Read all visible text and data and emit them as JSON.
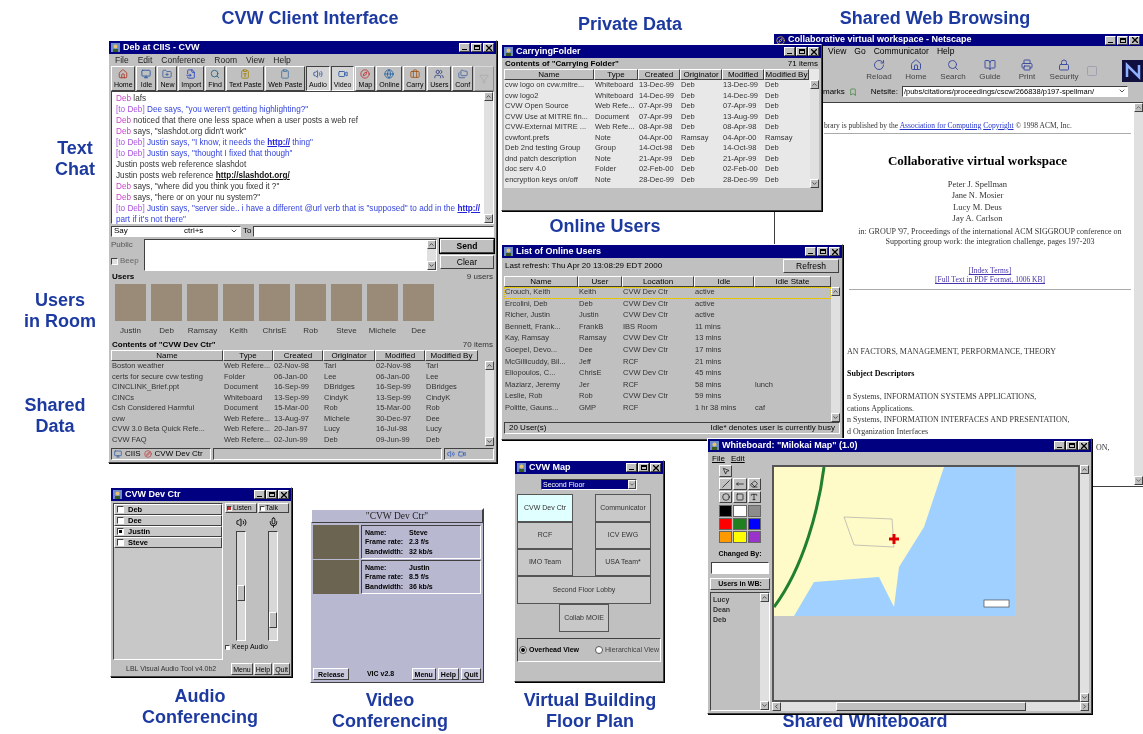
{
  "captions": [
    {
      "lines": [
        "CVW Client Interface"
      ]
    },
    {
      "lines": [
        "Private Data"
      ]
    },
    {
      "lines": [
        "Shared Web Browsing"
      ]
    },
    {
      "lines": [
        "Text",
        "Chat"
      ]
    },
    {
      "lines": [
        "Users",
        "in Room"
      ]
    },
    {
      "lines": [
        "Shared",
        "Data"
      ]
    },
    {
      "lines": [
        "Online Users"
      ]
    },
    {
      "lines": [
        "Audio",
        "Conferencing"
      ]
    },
    {
      "lines": [
        "Video",
        "Conferencing"
      ]
    },
    {
      "lines": [
        "Virtual Building",
        "Floor Plan"
      ]
    },
    {
      "lines": [
        "Shared Whiteboard"
      ]
    }
  ],
  "client": {
    "title": "Deb at CIIS - CVW",
    "menu": [
      "File",
      "Edit",
      "Conference",
      "Room",
      "View",
      "Help"
    ],
    "toolbar": [
      {
        "label": "Home",
        "pressed": false,
        "disabled": false
      },
      {
        "label": "Idle",
        "pressed": false,
        "disabled": false
      },
      {
        "label": "New",
        "pressed": false,
        "disabled": false
      },
      {
        "label": "Import",
        "pressed": false,
        "disabled": false
      },
      {
        "label": "Find",
        "pressed": false,
        "disabled": false
      },
      {
        "label": "Text Paste",
        "pressed": false,
        "disabled": false
      },
      {
        "label": "Web Paste",
        "pressed": false,
        "disabled": false
      },
      {
        "label": "Audio",
        "pressed": true,
        "disabled": false
      },
      {
        "label": "Video",
        "pressed": true,
        "disabled": false
      },
      {
        "label": "Map",
        "pressed": false,
        "disabled": false
      },
      {
        "label": "Online",
        "pressed": false,
        "disabled": false
      },
      {
        "label": "Carry",
        "pressed": false,
        "disabled": false
      },
      {
        "label": "Users",
        "pressed": false,
        "disabled": false
      },
      {
        "label": "Conf",
        "pressed": false,
        "disabled": false
      },
      {
        "pressed": false,
        "disabled": true
      }
    ],
    "chat": [
      {
        "kind": "say",
        "who": "Deb",
        "text": "lafs"
      },
      {
        "kind": "private",
        "prefix": "[to Deb]",
        "text": "Dee says, \"you weren't getting highlighting?\""
      },
      {
        "kind": "say",
        "who": "Deb",
        "text": "noticed that there one less space when a user posts a web ref"
      },
      {
        "kind": "say",
        "who": "Deb",
        "text": "says, \"slashdot.org didn't work\""
      },
      {
        "kind": "private",
        "prefix": "[to Deb]",
        "text": "Justin says, \"I know, it needs the",
        "link": "http://",
        "rest": "thing\""
      },
      {
        "kind": "private",
        "prefix": "[to Deb]",
        "text": "Justin says, \"thought I fixed that though\""
      },
      {
        "kind": "plain",
        "text": "Justin posts web reference slashdot"
      },
      {
        "kind": "plain",
        "text": "Justin posts web reference",
        "link": "http://slashdot.org/"
      },
      {
        "kind": "say",
        "who": "Deb",
        "text": "says, \"where did you think you fixed it ?\""
      },
      {
        "kind": "say",
        "who": "Deb",
        "text": "says, \"here or on your nu system?\""
      },
      {
        "kind": "private",
        "prefix": "[to Deb]",
        "text": "Justin says, \"server side.. i have a different @url verb that is \"supposed\" to add in the",
        "link": "http://",
        "rest": "part if it's not there\""
      }
    ],
    "say": {
      "mode": "Say",
      "shortcut": "ctrl+s",
      "to_label": "To"
    },
    "public_label": "Public",
    "beep": {
      "label": "Beep",
      "checked": false
    },
    "send": "Send",
    "clear": "Clear",
    "users_label": "Users",
    "users_count": "9 users",
    "users": [
      "Justin",
      "Deb",
      "Ramsay",
      "Keith",
      "ChrisE",
      "Rob",
      "Steve",
      "Michele",
      "Dee"
    ],
    "contents_title": "Contents of \"CVW Dev Ctr\"",
    "contents_count": "70 items",
    "columns": [
      "Name",
      "Type",
      "Created",
      "Originator",
      "Modified",
      "Modified By"
    ],
    "rows": [
      [
        "Boston weather",
        "Web Refere...",
        "02-Nov-98",
        "Tari",
        "02-Nov-98",
        "Tari"
      ],
      [
        "certs for secure cvw testing",
        "Folder",
        "06-Jan-00",
        "Lee",
        "06-Jan-00",
        "Lee"
      ],
      [
        "CINCLINK_Brief.ppt",
        "Document",
        "16-Sep-99",
        "DBridges",
        "16-Sep-99",
        "DBridges"
      ],
      [
        "CINCs",
        "Whiteboard",
        "13-Sep-99",
        "CindyK",
        "13-Sep-99",
        "CindyK"
      ],
      [
        "Csh Considered Harmful",
        "Document",
        "15-Mar-00",
        "Rob",
        "15-Mar-00",
        "Rob"
      ],
      [
        "cvw",
        "Web Refere...",
        "13-Aug-97",
        "Michele",
        "30-Dec-97",
        "Dee"
      ],
      [
        "CVW 3.0 Beta Quick Refe...",
        "Web Refere...",
        "20-Jan-97",
        "Lucy",
        "16-Jul-98",
        "Lucy"
      ],
      [
        "CVW FAQ",
        "Web Refere...",
        "02-Jun-99",
        "Deb",
        "09-Jun-99",
        "Deb"
      ]
    ],
    "status": [
      "CIIS",
      "CVW Dev Ctr"
    ]
  },
  "carrying": {
    "title": "CarryingFolder",
    "header": "Contents of \"Carrying Folder\"",
    "count": "71 items",
    "columns": [
      "Name",
      "Type",
      "Created",
      "Originator",
      "Modified",
      "Modified By"
    ],
    "rows": [
      [
        "cvw logo on cvw.mitre...",
        "Whiteboard",
        "13-Dec-99",
        "Deb",
        "13-Dec-99",
        "Deb"
      ],
      [
        "cvw logo2",
        "Whiteboard",
        "14-Dec-99",
        "Deb",
        "14-Dec-99",
        "Deb"
      ],
      [
        "CVW Open Source",
        "Web Refe...",
        "07-Apr-99",
        "Deb",
        "07-Apr-99",
        "Deb"
      ],
      [
        "CVW Use at MITRE fin...",
        "Document",
        "07-Apr-99",
        "Deb",
        "13-Aug-99",
        "Deb"
      ],
      [
        "CVW-External MITRE ...",
        "Web Refe...",
        "08-Apr-98",
        "Deb",
        "08-Apr-98",
        "Deb"
      ],
      [
        "cvwfont.prefs",
        "Note",
        "04-Apr-00",
        "Ramsay",
        "04-Apr-00",
        "Ramsay"
      ],
      [
        "Deb 2nd testing Group",
        "Group",
        "14-Oct-98",
        "Deb",
        "14-Oct-98",
        "Deb"
      ],
      [
        "dnd patch description",
        "Note",
        "21-Apr-99",
        "Deb",
        "21-Apr-99",
        "Deb"
      ],
      [
        "doc serv 4.0",
        "Folder",
        "02-Feb-00",
        "Deb",
        "02-Feb-00",
        "Deb"
      ],
      [
        "encryption keys on/off",
        "Note",
        "28-Dec-99",
        "Deb",
        "28-Dec-99",
        "Deb"
      ]
    ]
  },
  "browser": {
    "title": "Collaborative virtual workspace - Netscape",
    "menu": [
      "View",
      "Go",
      "Communicator",
      "Help"
    ],
    "toolbar": [
      "Reload",
      "Home",
      "Search",
      "Guide",
      "Print",
      "Security"
    ],
    "bookmarks": "marks",
    "location_label": "Netsite:",
    "url": "/pubs/citations/proceedings/cscw/266838/p197-spellman/",
    "publisher": {
      "text": "brary is published by the",
      "links": [
        "Association for Computing",
        "Copyright"
      ],
      "rest": "© 1998 ACM, Inc."
    },
    "heading": "Collaborative virtual workspace",
    "authors": [
      "Peter J. Spellman",
      "Jane N. Mosier",
      "Lucy M. Deus",
      "Jay A. Carlson"
    ],
    "citation": "in: GROUP '97, Proceedings of the international ACM SIGGROUP conference on Supporting group work: the integration challenge, pages 197-203",
    "links": [
      "[Index Terms]",
      "[Full Text in PDF Format, 1006 KB]"
    ],
    "terms": "AN FACTORS, MANAGEMENT, PERFORMANCE, THEORY",
    "subject_heading": "Subject Descriptors",
    "descriptors": [
      "n Systems, INFORMATION SYSTEMS APPLICATIONS,",
      "cations Applications.",
      "n Systems, INFORMATION INTERFACES AND PRESENTATION,",
      "d Organization Interfaces"
    ],
    "tail": "ON,"
  },
  "online": {
    "title": "List of Online Users",
    "refresh_text": "Last refresh:  Thu Apr 20 13:08:29 EDT 2000",
    "refresh_button": "Refresh",
    "columns": [
      "Name",
      "User",
      "Location",
      "Idle",
      "Idle State"
    ],
    "rows": [
      {
        "cells": [
          "Crouch, Keith",
          "Keith",
          "CVW Dev Ctr",
          "active",
          ""
        ],
        "selected": true
      },
      {
        "cells": [
          "Ercolini, Deb",
          "Deb",
          "CVW Dev Ctr",
          "active",
          ""
        ],
        "selected": false
      },
      {
        "cells": [
          "Richer, Justin",
          "Justin",
          "CVW Dev Ctr",
          "active",
          ""
        ],
        "selected": false
      },
      {
        "cells": [
          "Bennett, Frank...",
          "FrankB",
          "IBS Room",
          "11 mins",
          ""
        ],
        "selected": false
      },
      {
        "cells": [
          "Kay, Ramsay",
          "Ramsay",
          "CVW Dev Ctr",
          "13 mins",
          ""
        ],
        "selected": false
      },
      {
        "cells": [
          "Goepel, Devo...",
          "Dee",
          "CVW Dev Ctr",
          "17 mins",
          ""
        ],
        "selected": false
      },
      {
        "cells": [
          "McGillicuddy, Bil...",
          "Jeff",
          "RCF",
          "21 mins",
          ""
        ],
        "selected": false
      },
      {
        "cells": [
          "Eliopoulos, C...",
          "ChrisE",
          "CVW Dev Ctr",
          "45 mins",
          ""
        ],
        "selected": false
      },
      {
        "cells": [
          "Maziarz, Jeremy",
          "Jer",
          "RCF",
          "58 mins",
          "lunch"
        ],
        "selected": false
      },
      {
        "cells": [
          "Leslie, Rob",
          "Rob",
          "CVW Dev Ctr",
          "59 mins",
          ""
        ],
        "selected": false
      },
      {
        "cells": [
          "Politte, Gauns...",
          "GMP",
          "RCF",
          "1 hr 38 mins",
          "caf"
        ],
        "selected": false
      }
    ],
    "footer_count": "20 User(s)",
    "footer_note": "Idle* denotes user is currently busy"
  },
  "audio": {
    "title": "CVW Dev Ctr",
    "participants": [
      {
        "name": "Deb",
        "checked": false
      },
      {
        "name": "Dee",
        "checked": false
      },
      {
        "name": "Justin",
        "checked": true
      },
      {
        "name": "Steve",
        "checked": false
      }
    ],
    "listen": {
      "label": "Listen",
      "checked": true,
      "level": 0.42
    },
    "talk": {
      "label": "Talk",
      "checked": false,
      "level": 0.13
    },
    "keep": {
      "label": "Keep Audio",
      "checked": false
    },
    "version": "LBL Visual Audio Tool v4.0b2",
    "buttons": [
      "Menu",
      "Help",
      "Quit"
    ]
  },
  "video": {
    "title": "\"CVW Dev Ctr\"",
    "streams": [
      {
        "fields": [
          {
            "label": "Name:",
            "value": "Steve"
          },
          {
            "label": "Frame rate:",
            "value": "2.3 f/s"
          },
          {
            "label": "Bandwidth:",
            "value": "32 kb/s"
          }
        ]
      },
      {
        "fields": [
          {
            "label": "Name:",
            "value": "Justin"
          },
          {
            "label": "Frame rate:",
            "value": "8.5 f/s"
          },
          {
            "label": "Bandwidth:",
            "value": "36 kb/s"
          }
        ]
      }
    ],
    "release": "Release",
    "version": "VIC v2.8",
    "buttons": [
      "Menu",
      "Help",
      "Quit"
    ]
  },
  "map": {
    "title": "CVW Map",
    "floor": "Second Floor",
    "rooms": [
      {
        "name": "CVW Dev Ctr",
        "selected": true
      },
      {
        "name": "Communicator",
        "selected": false
      },
      {
        "name": "RCF",
        "selected": false
      },
      {
        "name": "ICV EWG",
        "selected": false
      },
      {
        "name": "IMO Team",
        "selected": false
      },
      {
        "name": "USA Team*",
        "selected": false
      },
      {
        "name": "Second Floor Lobby",
        "selected": false
      },
      {
        "name": "Collab MOIE",
        "selected": false
      }
    ],
    "views": [
      {
        "label": "Overhead View",
        "selected": true
      },
      {
        "label": "Hierarchical View",
        "selected": false
      }
    ]
  },
  "whiteboard": {
    "title": "Whiteboard: \"Milokai Map\" (1.0)",
    "menu": [
      "File",
      "Edit"
    ],
    "palette": [
      {
        "color": "#000000"
      },
      {
        "color": "#ffffff"
      },
      {
        "color": "#8c8c8c"
      },
      {
        "color": "#ff0000"
      },
      {
        "color": "#208020"
      },
      {
        "color": "#0000ff"
      },
      {
        "color": "#ff9900"
      },
      {
        "color": "#ffff00"
      },
      {
        "color": "#9933cc"
      }
    ],
    "changed_by": "Changed By:",
    "users_header": "Users in WB:",
    "users": [
      "Lucy",
      "Dean",
      "Deb"
    ]
  }
}
